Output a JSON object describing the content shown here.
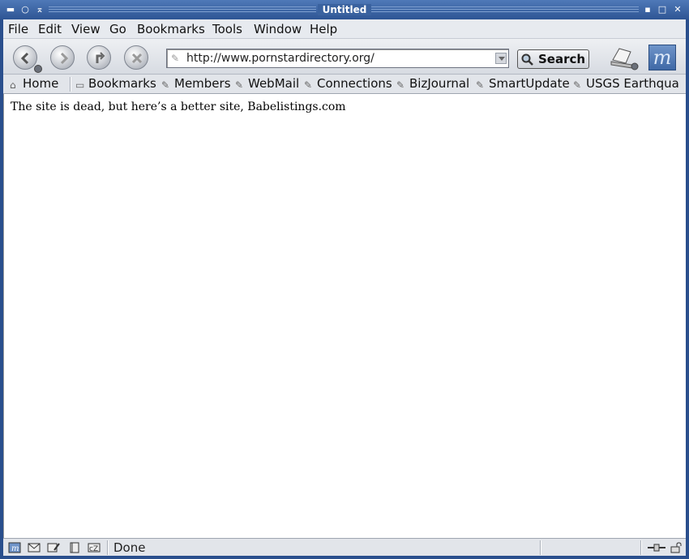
{
  "window": {
    "title": "Untitled"
  },
  "menubar": {
    "items": [
      {
        "label": "File"
      },
      {
        "label": "Edit"
      },
      {
        "label": "View"
      },
      {
        "label": "Go"
      },
      {
        "label": "Bookmarks"
      },
      {
        "label": "Tools"
      },
      {
        "label": "Window"
      },
      {
        "label": "Help"
      }
    ]
  },
  "navbar": {
    "url": "http://www.pornstardirectory.org/",
    "search_label": "Search",
    "back_icon": "back-arrow-icon",
    "forward_icon": "forward-arrow-icon",
    "reload_icon": "reload-icon",
    "stop_icon": "stop-icon",
    "print_icon": "print-icon",
    "logo_icon": "mozilla-m-logo"
  },
  "personalbar": {
    "items": [
      {
        "label": "Home",
        "icon": "home-icon"
      },
      {
        "label": "Bookmarks",
        "icon": "folder-icon"
      },
      {
        "label": "Members",
        "icon": "bookmark-icon"
      },
      {
        "label": "WebMail",
        "icon": "bookmark-icon"
      },
      {
        "label": "Connections",
        "icon": "bookmark-icon"
      },
      {
        "label": "BizJournal",
        "icon": "bookmark-icon"
      },
      {
        "label": "SmartUpdate",
        "icon": "bookmark-icon"
      },
      {
        "label": "USGS Earthqua",
        "icon": "bookmark-icon"
      }
    ]
  },
  "content": {
    "text": "The site is dead, but here’s a better site, Babelistings.com"
  },
  "statusbar": {
    "status": "Done"
  },
  "colors": {
    "titlebar": "#2e5594",
    "toolbar": "#e2e5ea",
    "page_bg": "#ffffff"
  }
}
